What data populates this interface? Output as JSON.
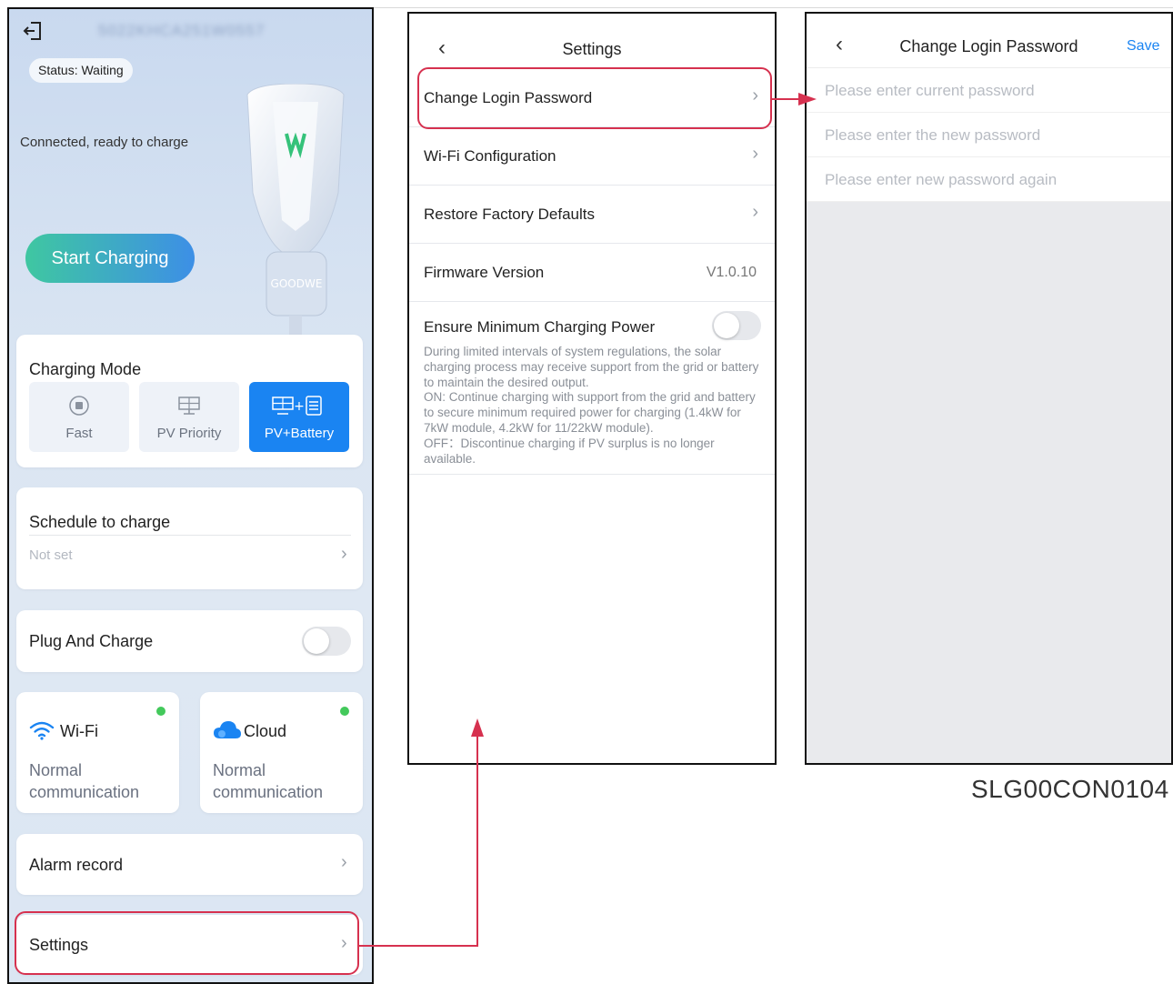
{
  "home": {
    "serial_number": "5022KHCA251W0557",
    "status_label": "Status:",
    "status_value": "Waiting",
    "connection_text": "Connected, ready to charge",
    "start_button": "Start Charging",
    "brand": "GOODWE",
    "charging_mode": {
      "title": "Charging Mode",
      "options": [
        {
          "label": "Fast",
          "icon": "plug-icon",
          "selected": false
        },
        {
          "label": "PV Priority",
          "icon": "solar-panel-icon",
          "selected": false
        },
        {
          "label": "PV+Battery",
          "icon": "solar-battery-icon",
          "selected": true
        }
      ]
    },
    "schedule": {
      "title": "Schedule to charge",
      "value": "Not set"
    },
    "plug_and_charge": {
      "title": "Plug And Charge",
      "enabled": false
    },
    "wifi": {
      "title": "Wi-Fi",
      "status": "Normal communication",
      "icon": "wifi-icon"
    },
    "cloud": {
      "title": "Cloud",
      "status": "Normal communication",
      "icon": "cloud-icon"
    },
    "alarm_record": "Alarm record",
    "settings": "Settings"
  },
  "settings_screen": {
    "title": "Settings",
    "rows": [
      {
        "label": "Change Login Password"
      },
      {
        "label": "Wi-Fi Configuration"
      },
      {
        "label": "Restore Factory Defaults"
      }
    ],
    "firmware": {
      "label": "Firmware Version",
      "value": "V1.0.10"
    },
    "ensure_min_power": {
      "label": "Ensure Minimum Charging Power",
      "enabled": false,
      "description": "During limited intervals of system regulations, the solar charging process may receive support from the grid or battery to maintain the desired output.\nON: Continue charging with support from the grid and battery to secure minimum required power for charging (1.4kW for 7kW module, 4.2kW for 11/22kW module).\nOFF：Discontinue charging if PV surplus is no longer available."
    }
  },
  "password_screen": {
    "title": "Change Login Password",
    "save": "Save",
    "fields": [
      {
        "placeholder": "Please enter current password",
        "value": ""
      },
      {
        "placeholder": "Please enter the new password",
        "value": ""
      },
      {
        "placeholder": "Please enter new password again",
        "value": ""
      }
    ]
  },
  "caption": "SLG00CON0104",
  "colors": {
    "accent": "#1a84f2",
    "highlight": "#d6314f",
    "status_ok": "#43c95b"
  }
}
